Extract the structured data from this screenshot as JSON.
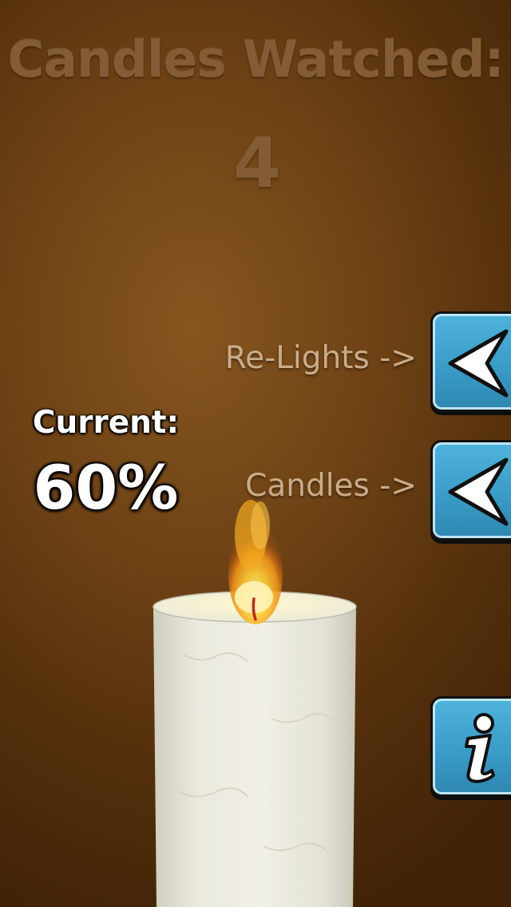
{
  "header": {
    "title": "Candles Watched:",
    "count": "4"
  },
  "buttons": {
    "relights_label": "Re-Lights ->",
    "candles_label": "Candles ->",
    "relights_icon": "back-arrow-icon",
    "candles_icon": "back-arrow-icon",
    "info_icon": "info-icon"
  },
  "status": {
    "current_label": "Current:",
    "current_value": "60%",
    "current_fraction": 0.6
  },
  "colors": {
    "background": "#6e4215",
    "button": "#3a9cc7",
    "title_text": "#835c36",
    "flame": "#f4a21c",
    "candle": "#ecebe0"
  }
}
